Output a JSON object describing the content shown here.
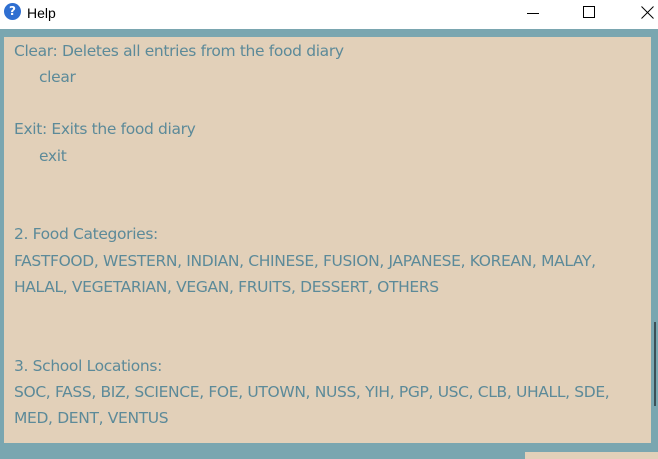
{
  "window": {
    "title": "Help",
    "icon": "question-icon",
    "controls": [
      "minimize-icon",
      "maximize-icon",
      "close-icon"
    ]
  },
  "help": {
    "lines": [
      "Clear: Deletes all entries from the food diary",
      "clear",
      "Exit: Exits the food diary",
      "exit",
      "2. Food Categories:",
      "FASTFOOD, WESTERN, INDIAN, CHINESE, FUSION, JAPANESE, KOREAN, MALAY,",
      "HALAL, VEGETARIAN, VEGAN, FRUITS, DESSERT, OTHERS",
      "3. School Locations:",
      "SOC, FASS, BIZ, SCIENCE, FOE, UTOWN, NUSS, YIH, PGP, USC, CLB, UHALL, SDE,",
      "MED, DENT, VENTUS"
    ]
  },
  "colors": {
    "window_background": "#7aa6b0",
    "panel_background": "#e2d0b9",
    "help_text": "#5c8a99"
  }
}
